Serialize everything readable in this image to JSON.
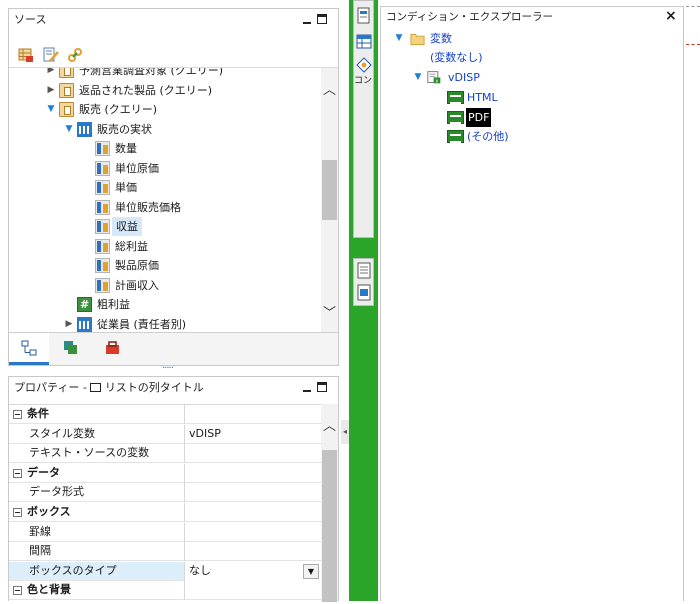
{
  "source_panel": {
    "title": "ソース",
    "toolbar_icons": [
      "insert-field-icon",
      "edit-icon",
      "link-icon"
    ],
    "tree": [
      {
        "label": "予測営業調査対象 (クエリー)",
        "indent": 1,
        "arrow": "collapsed",
        "icon": "query",
        "partial": true
      },
      {
        "label": "返品された製品 (クエリー)",
        "indent": 1,
        "arrow": "collapsed",
        "icon": "query"
      },
      {
        "label": "販売 (クエリー)",
        "indent": 1,
        "arrow": "expanded",
        "icon": "query"
      },
      {
        "label": "販売の実状",
        "indent": 2,
        "arrow": "expanded",
        "icon": "table"
      },
      {
        "label": "数量",
        "indent": 3,
        "icon": "field"
      },
      {
        "label": "単位原価",
        "indent": 3,
        "icon": "field"
      },
      {
        "label": "単価",
        "indent": 3,
        "icon": "field"
      },
      {
        "label": "単位販売価格",
        "indent": 3,
        "icon": "field"
      },
      {
        "label": "収益",
        "indent": 3,
        "icon": "field",
        "selected": true
      },
      {
        "label": "総利益",
        "indent": 3,
        "icon": "field"
      },
      {
        "label": "製品原価",
        "indent": 3,
        "icon": "field"
      },
      {
        "label": "計画収入",
        "indent": 3,
        "icon": "field"
      },
      {
        "label": "粗利益",
        "indent": 2,
        "icon": "calc"
      },
      {
        "label": "従業員 (責任者別)",
        "indent": 2,
        "arrow": "collapsed",
        "icon": "table"
      }
    ],
    "tabs": [
      "source-tree-tab",
      "data-items-tab",
      "toolbox-tab"
    ],
    "more_indicator": "....."
  },
  "properties_panel": {
    "title_prefix": "プロパティー - ",
    "title_object": "リストの列タイトル",
    "rows": [
      {
        "name": "条件",
        "value": "",
        "category": true
      },
      {
        "name": "スタイル変数",
        "value": "vDISP"
      },
      {
        "name": "テキスト・ソースの変数",
        "value": ""
      },
      {
        "name": "データ",
        "value": "",
        "category": true
      },
      {
        "name": "データ形式",
        "value": ""
      },
      {
        "name": "ボックス",
        "value": "",
        "category": true
      },
      {
        "name": "罫線",
        "value": ""
      },
      {
        "name": "間隔",
        "value": ""
      },
      {
        "name": "ボックスのタイプ",
        "value": "なし",
        "selected": true,
        "dropdown": true
      },
      {
        "name": "色と背景",
        "value": "",
        "category": true
      }
    ]
  },
  "side_toolbar": {
    "partial_label": "コン"
  },
  "condition_explorer": {
    "title": "コンディション・エクスプローラー",
    "close_label": "×",
    "folder_label": "変数",
    "no_variable_label": "(変数なし)",
    "variable_label": "vDISP",
    "values": [
      "HTML",
      "PDF",
      "(その他)"
    ],
    "selected_value": "PDF"
  },
  "colors": {
    "accent_green": "#2aa52a",
    "selection_blue": "#d5e8f7",
    "link_blue": "#1540c8"
  }
}
